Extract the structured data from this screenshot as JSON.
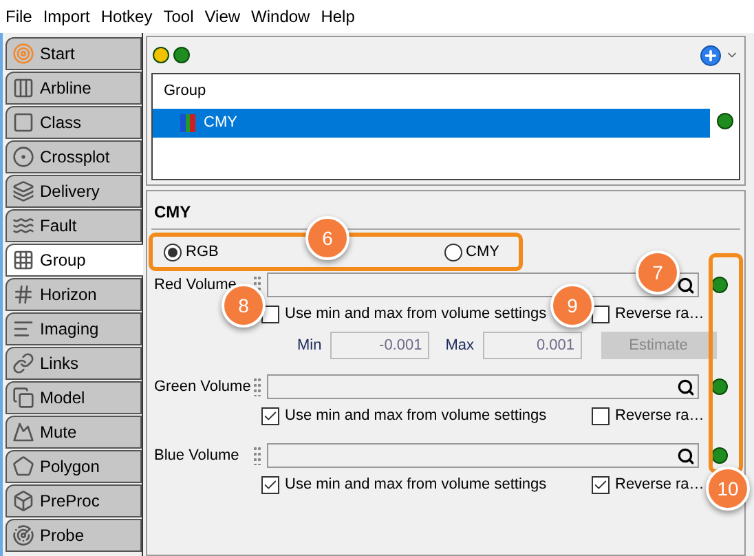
{
  "menu": [
    "File",
    "Import",
    "Hotkey",
    "Tool",
    "View",
    "Window",
    "Help"
  ],
  "sidebar": {
    "items": [
      {
        "label": "Start",
        "selected": false
      },
      {
        "label": "Arbline",
        "selected": false
      },
      {
        "label": "Class",
        "selected": false
      },
      {
        "label": "Crossplot",
        "selected": false
      },
      {
        "label": "Delivery",
        "selected": false
      },
      {
        "label": "Fault",
        "selected": false
      },
      {
        "label": "Group",
        "selected": true
      },
      {
        "label": "Horizon",
        "selected": false
      },
      {
        "label": "Imaging",
        "selected": false
      },
      {
        "label": "Links",
        "selected": false
      },
      {
        "label": "Model",
        "selected": false
      },
      {
        "label": "Mute",
        "selected": false
      },
      {
        "label": "Polygon",
        "selected": false
      },
      {
        "label": "PreProc",
        "selected": false
      },
      {
        "label": "Probe",
        "selected": false
      }
    ]
  },
  "toolbar": {
    "lights": [
      {
        "color": "#f2c200"
      },
      {
        "color": "#1e8c1e"
      }
    ]
  },
  "tree": {
    "header": "Group",
    "items": [
      {
        "label": "CMY",
        "selected": true
      }
    ]
  },
  "editor": {
    "title": "CMY",
    "mode": [
      {
        "label": "RGB",
        "selected": true
      },
      {
        "label": "CMY",
        "selected": false
      }
    ],
    "volumes": [
      {
        "label": "Red Volume",
        "use_label": "Use min and max from volume settings",
        "use_checked": false,
        "reverse_label": "Reverse ra…",
        "reverse_checked": false,
        "range": {
          "min_label": "Min",
          "min": "-0.001",
          "max_label": "Max",
          "max": "0.001",
          "button": "Estimate",
          "disabled": true
        }
      },
      {
        "label": "Green Volume",
        "use_label": "Use min and max from volume settings",
        "use_checked": true,
        "reverse_label": "Reverse ra…",
        "reverse_checked": false
      },
      {
        "label": "Blue Volume",
        "use_label": "Use min and max from volume settings",
        "use_checked": true,
        "reverse_label": "Reverse ra…",
        "reverse_checked": true
      }
    ]
  },
  "callouts": [
    "6",
    "7",
    "8",
    "9",
    "10"
  ]
}
